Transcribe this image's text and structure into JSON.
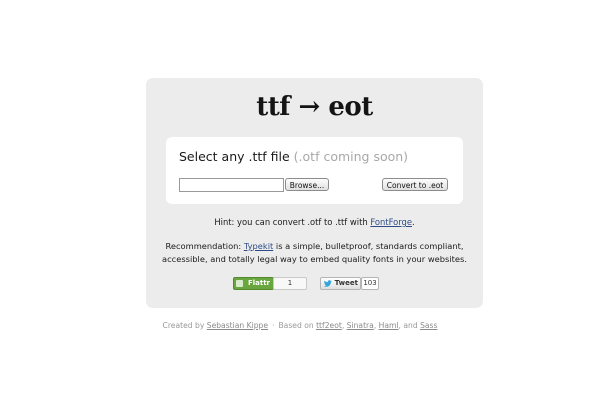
{
  "header": {
    "title": "ttf → eot"
  },
  "form": {
    "prompt": "Select any .ttf file",
    "prompt_note": "(.otf coming soon)",
    "file_value": "",
    "browse_label": "Browse...",
    "convert_label": "Convert to .eot"
  },
  "hint": {
    "before": "Hint: you can convert .otf to .ttf with ",
    "link": "FontForge",
    "after": "."
  },
  "recommendation": {
    "before": "Recommendation: ",
    "link": "Typekit",
    "after": " is a simple, bulletproof, standards compliant, accessible, and totally legal way to embed quality fonts in your websites."
  },
  "social": {
    "flattr_label": "Flattr",
    "flattr_count": "1",
    "tweet_label": "Tweet",
    "tweet_count": "103"
  },
  "footer": {
    "created_by": "Created by ",
    "author": "Sebastian Kippe",
    "separator": "·",
    "based_on": "Based on ",
    "tech1": "ttf2eot",
    "tech2": "Sinatra",
    "tech3": "Haml",
    "and": ", and ",
    "tech4": "Sass",
    "comma": ", "
  },
  "colors": {
    "card_bg": "#ececec",
    "link": "#2d4b86",
    "flattr_green": "#6aa640",
    "muted": "#a8a8a8"
  }
}
